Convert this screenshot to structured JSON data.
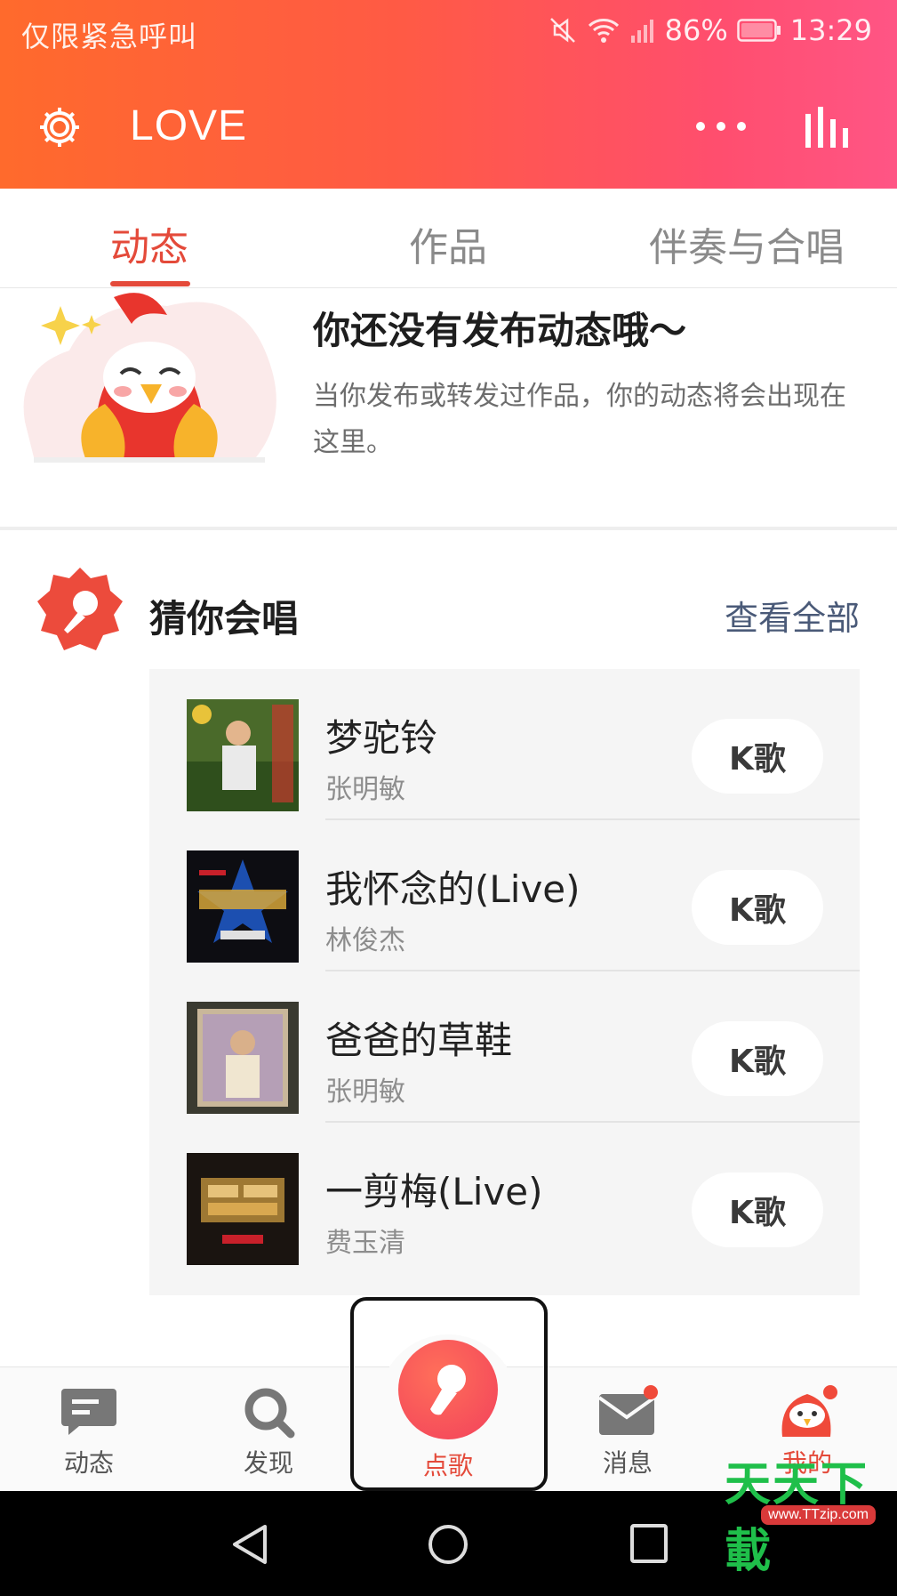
{
  "status_bar": {
    "carrier_text": "仅限紧急呼叫",
    "battery": "86%",
    "time": "13:29"
  },
  "top_bar": {
    "profile_name": "LOVE"
  },
  "tabs": [
    {
      "label": "动态",
      "active": true
    },
    {
      "label": "作品",
      "active": false
    },
    {
      "label": "伴奏与合唱",
      "active": false
    }
  ],
  "empty_state": {
    "title": "你还没有发布动态哦～",
    "description": "当你发布或转发过作品，你的动态将会出现在这里。"
  },
  "recommend": {
    "title": "猜你会唱",
    "view_all": "查看全部",
    "songs": [
      {
        "name": "梦驼铃",
        "artist": "张明敏",
        "button": "K歌"
      },
      {
        "name": "我怀念的(Live)",
        "artist": "林俊杰",
        "button": "K歌"
      },
      {
        "name": "爸爸的草鞋",
        "artist": "张明敏",
        "button": "K歌"
      },
      {
        "name": "一剪梅(Live)",
        "artist": "费玉清",
        "button": "K歌"
      }
    ]
  },
  "bottom_nav": {
    "items": [
      {
        "label": "动态",
        "icon": "chat-icon"
      },
      {
        "label": "发现",
        "icon": "search-icon"
      },
      {
        "label": "点歌",
        "icon": "microphone-icon"
      },
      {
        "label": "消息",
        "icon": "mail-icon",
        "badge": true
      },
      {
        "label": "我的",
        "icon": "mascot-icon",
        "badge": true,
        "active": true
      }
    ]
  },
  "watermark": {
    "brand": "天天下載",
    "url": "www.TTzip.com"
  },
  "colors": {
    "accent": "#e44a3a",
    "header_gradient_start": "#ff6a2c",
    "header_gradient_end": "#ff5585"
  }
}
